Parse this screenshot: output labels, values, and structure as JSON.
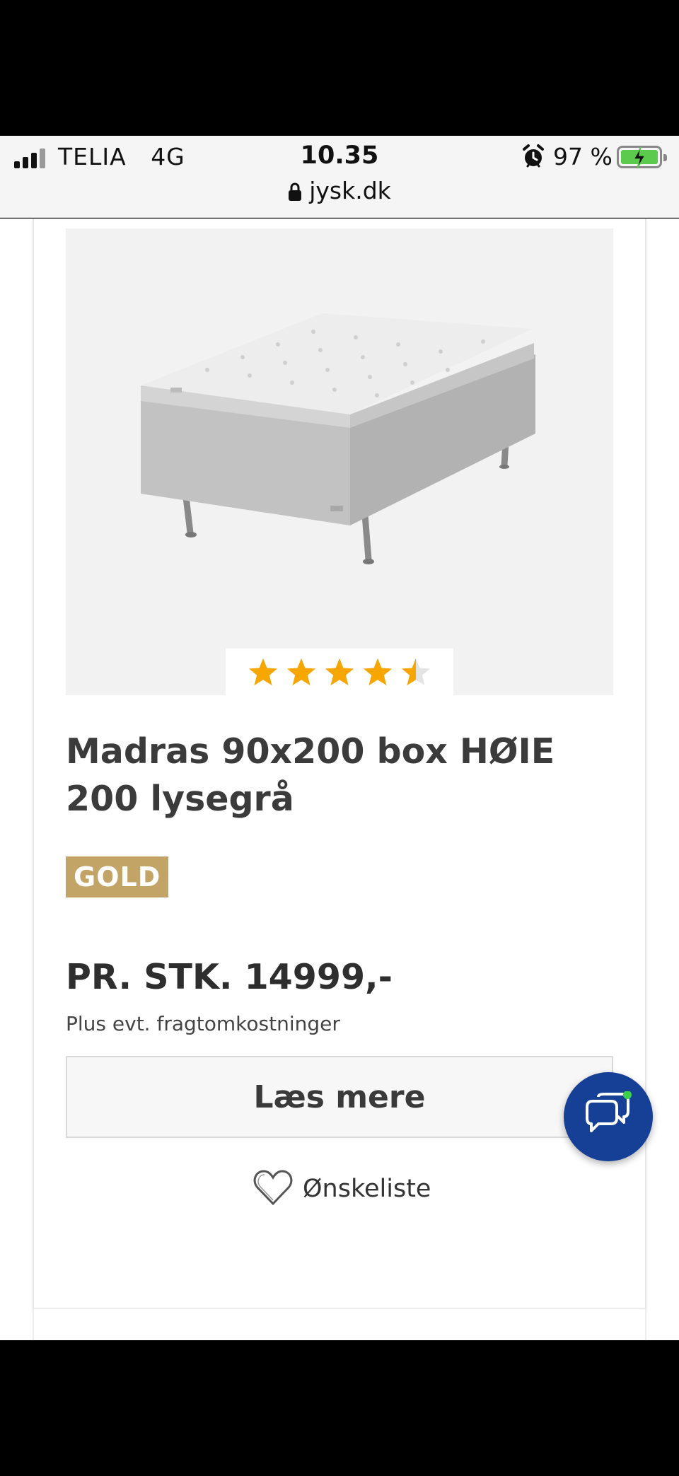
{
  "status_bar": {
    "carrier": "TELIA",
    "network": "4G",
    "time": "10.35",
    "battery": "97 %"
  },
  "browser": {
    "url": "jysk.dk"
  },
  "product": {
    "rating": 4.5,
    "rating_max": 5,
    "title": "Madras 90x200 box HØIE 200 lysegrå",
    "badge": "GOLD",
    "price": "PR. STK. 14999,-",
    "shipping_note": "Plus evt. fragtomkostninger",
    "read_more_label": "Læs mere",
    "wishlist_label": "Ønskeliste"
  },
  "colors": {
    "star": "#f7a600",
    "badge": "#c2a466",
    "chat_button": "#163f96",
    "online_dot": "#3bd14a",
    "battery": "#5ccb4d"
  },
  "icons": {
    "status": [
      "signal-icon",
      "alarm-icon",
      "battery-icon"
    ],
    "address_bar": "lock-icon",
    "product": [
      "star-icon",
      "heart-icon"
    ],
    "chat": "chat-icon"
  }
}
